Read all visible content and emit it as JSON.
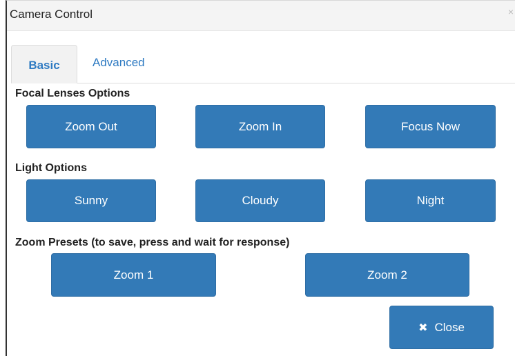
{
  "dialog": {
    "title": "Camera Control",
    "close_glyph": "×"
  },
  "tabs": [
    {
      "label": "Basic",
      "active": true
    },
    {
      "label": "Advanced",
      "active": false
    }
  ],
  "sections": {
    "focal": {
      "label": "Focal Lenses Options",
      "buttons": [
        "Zoom Out",
        "Zoom In",
        "Focus Now"
      ]
    },
    "light": {
      "label": "Light Options",
      "buttons": [
        "Sunny",
        "Cloudy",
        "Night"
      ]
    },
    "presets": {
      "label": "Zoom Presets (to save, press and wait for response)",
      "buttons": [
        "Zoom 1",
        "Zoom 2"
      ]
    }
  },
  "footer": {
    "close_label": "Close",
    "close_icon": "times-icon"
  },
  "colors": {
    "button_bg": "#337ab7",
    "tab_text": "#2e7ac2"
  }
}
